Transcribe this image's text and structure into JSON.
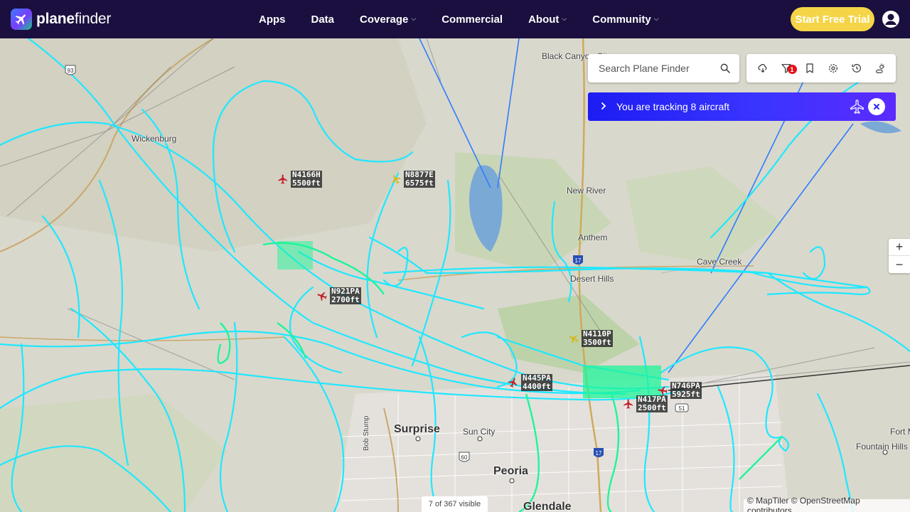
{
  "brand": {
    "name_bold": "plane",
    "name_light": "finder"
  },
  "nav": {
    "items": [
      {
        "label": "Apps",
        "dropdown": false
      },
      {
        "label": "Data",
        "dropdown": false
      },
      {
        "label": "Coverage",
        "dropdown": true
      },
      {
        "label": "Commercial",
        "dropdown": false
      },
      {
        "label": "About",
        "dropdown": true
      },
      {
        "label": "Community",
        "dropdown": true
      }
    ],
    "cta_label": "Start Free Trial"
  },
  "search": {
    "placeholder": "Search Plane Finder",
    "value": ""
  },
  "toolbar": {
    "buttons": [
      "weather-icon",
      "filter-icon",
      "bookmark-icon",
      "settings-icon",
      "history-icon",
      "sun-weather-icon"
    ],
    "filter_badge": "1"
  },
  "tracking": {
    "message": "You are tracking 8 aircraft"
  },
  "zoom": {
    "in": "+",
    "out": "−"
  },
  "map": {
    "places": [
      {
        "name": "Black Canyon City",
        "big": false
      },
      {
        "name": "Wickenburg",
        "big": false
      },
      {
        "name": "New River",
        "big": false
      },
      {
        "name": "Anthem",
        "big": false
      },
      {
        "name": "Desert Hills",
        "big": false
      },
      {
        "name": "Cave Creek",
        "big": false
      },
      {
        "name": "Surprise",
        "big": true
      },
      {
        "name": "Sun City",
        "big": false
      },
      {
        "name": "Peoria",
        "big": true
      },
      {
        "name": "Glendale",
        "big": true
      },
      {
        "name": "Fountain Hills",
        "big": false
      },
      {
        "name": "Fort M",
        "big": false
      },
      {
        "name": "Bob Stump",
        "big": false
      }
    ],
    "shields": [
      "93",
      "17",
      "60",
      "17",
      "51"
    ],
    "aircraft": [
      {
        "callsign": "N4166H",
        "altitude": "5500ft",
        "color": "#c0202a"
      },
      {
        "callsign": "N8877E",
        "altitude": "6575ft",
        "color": "#d4b81c"
      },
      {
        "callsign": "N921PA",
        "altitude": "2700ft",
        "color": "#c0202a"
      },
      {
        "callsign": "N4110P",
        "altitude": "3500ft",
        "color": "#d4b81c"
      },
      {
        "callsign": "N445PA",
        "altitude": "4400ft",
        "color": "#c0202a"
      },
      {
        "callsign": "N746PA",
        "altitude": "5925ft",
        "color": "#c0202a"
      },
      {
        "callsign": "N417PA",
        "altitude": "2500ft",
        "color": "#c0202a"
      }
    ]
  },
  "status": {
    "visible_count": "7 of 367 visible"
  },
  "attribution": "© MapTiler © OpenStreetMap contributors",
  "colors": {
    "nav_bg": "#1a0f3e",
    "cta": "#f5d547",
    "track": "#1ee8ff",
    "track_alt": "#1ef59a",
    "tracking_bar": "#2a2af5"
  }
}
